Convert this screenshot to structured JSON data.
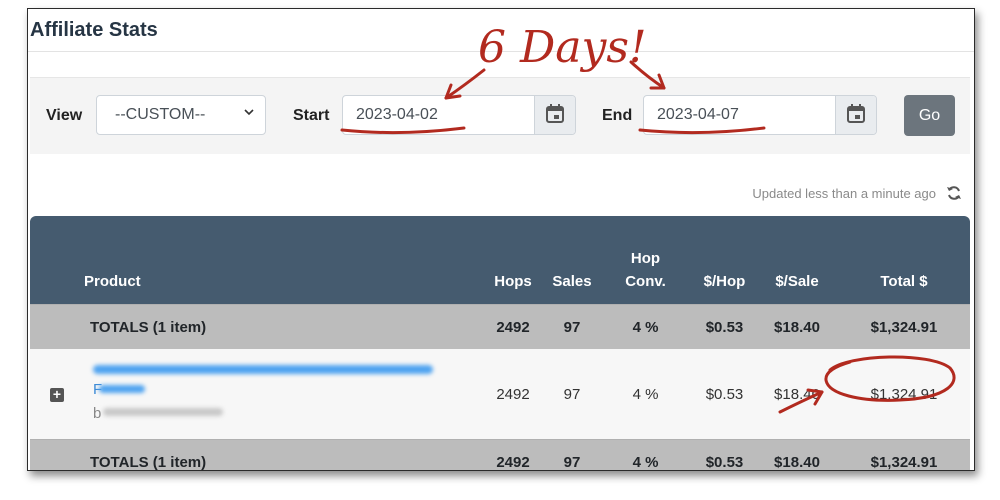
{
  "page": {
    "title": "Affiliate Stats"
  },
  "filters": {
    "view_label": "View",
    "view_value": "--CUSTOM--",
    "start_label": "Start",
    "start_value": "2023-04-02",
    "end_label": "End",
    "end_value": "2023-04-07",
    "go_label": "Go"
  },
  "status": {
    "updated_text": "Updated less than a minute ago"
  },
  "table": {
    "headers": {
      "product": "Product",
      "hops": "Hops",
      "sales": "Sales",
      "hop_conv_line1": "Hop",
      "hop_conv_line2": "Conv.",
      "per_hop": "$/Hop",
      "per_sale": "$/Sale",
      "total": "Total $"
    },
    "totals_top": {
      "label": "TOTALS (1 item)",
      "hops": "2492",
      "sales": "97",
      "conv": "4 %",
      "per_hop": "$0.53",
      "per_sale": "$18.40",
      "total": "$1,324.91"
    },
    "item": {
      "name_line2": "F",
      "name_line3": "b",
      "hops": "2492",
      "sales": "97",
      "conv": "4 %",
      "per_hop": "$0.53",
      "per_sale": "$18.40",
      "total": "$1,324.91"
    },
    "totals_bottom": {
      "label": "TOTALS (1 item)",
      "hops": "2492",
      "sales": "97",
      "conv": "4 %",
      "per_hop": "$0.53",
      "per_sale": "$18.40",
      "total": "$1,324.91"
    }
  },
  "annotation": {
    "text": "6 Days!",
    "color": "#b22a1f"
  },
  "icons": {
    "calendar": "calendar-icon",
    "refresh": "refresh-icon",
    "expand": "expand-plus-icon",
    "chevron": "chevron-down-icon"
  }
}
